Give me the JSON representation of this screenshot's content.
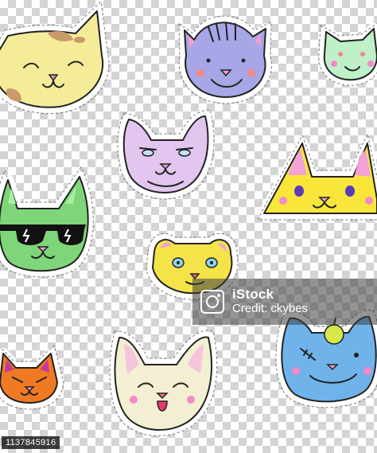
{
  "watermark": {
    "brand": "iStock",
    "credit": "Credit: ckybes"
  },
  "image_id": "1137845916",
  "colors": {
    "outline": "#222222",
    "sticker_border": "#ffffff",
    "dash": "#777777",
    "cream": "#f5ec9a",
    "periwinkle": "#a7a6e6",
    "mint": "#bff0c8",
    "lilac": "#e2c6ef",
    "yellow": "#f9e63b",
    "green": "#7fd67a",
    "sunny": "#f4e44a",
    "orange": "#f07a24",
    "ivory": "#f3efd2",
    "sky": "#6fb3ea"
  },
  "stickers": [
    {
      "name": "cream-cat-sticker",
      "color": "cream"
    },
    {
      "name": "periwinkle-cat-sticker",
      "color": "periwinkle"
    },
    {
      "name": "mint-cat-sticker",
      "color": "mint"
    },
    {
      "name": "lilac-cat-sticker",
      "color": "lilac"
    },
    {
      "name": "yellow-cat-sticker",
      "color": "yellow"
    },
    {
      "name": "green-cool-cat-sticker",
      "color": "green"
    },
    {
      "name": "sunny-cat-sticker",
      "color": "sunny"
    },
    {
      "name": "orange-cat-sticker",
      "color": "orange"
    },
    {
      "name": "ivory-cat-sticker",
      "color": "ivory"
    },
    {
      "name": "blue-cat-sticker",
      "color": "sky"
    }
  ]
}
